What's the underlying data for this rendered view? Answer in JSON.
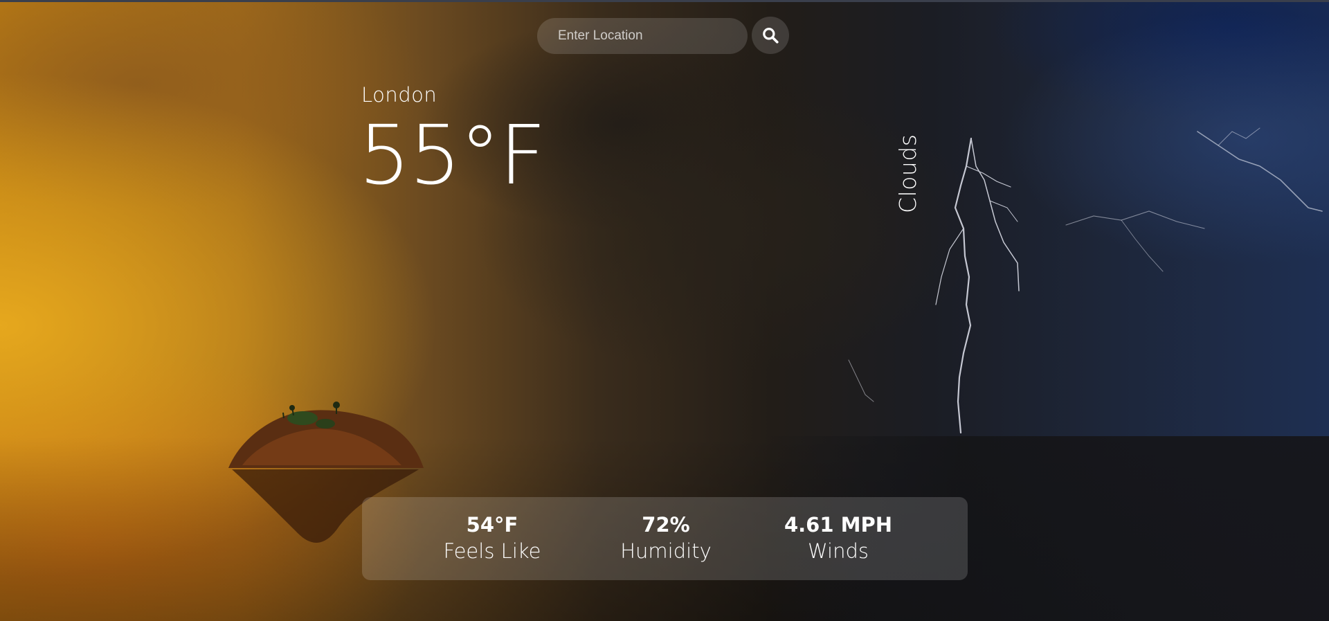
{
  "search": {
    "placeholder": "Enter Location",
    "value": "",
    "button_icon": "search-icon"
  },
  "weather": {
    "city": "London",
    "temperature": "55°F",
    "condition": "Clouds"
  },
  "stats": {
    "feels_like_value": "54°F",
    "feels_like_label": "Feels Like",
    "humidity_value": "72%",
    "humidity_label": "Humidity",
    "wind_value": "4.61 MPH",
    "wind_label": "Winds"
  },
  "colors": {
    "text": "#ffffff",
    "sky_warm": "#b87a14",
    "sky_storm": "#1e2f52",
    "panel": "rgba(255,255,255,0.16)"
  }
}
